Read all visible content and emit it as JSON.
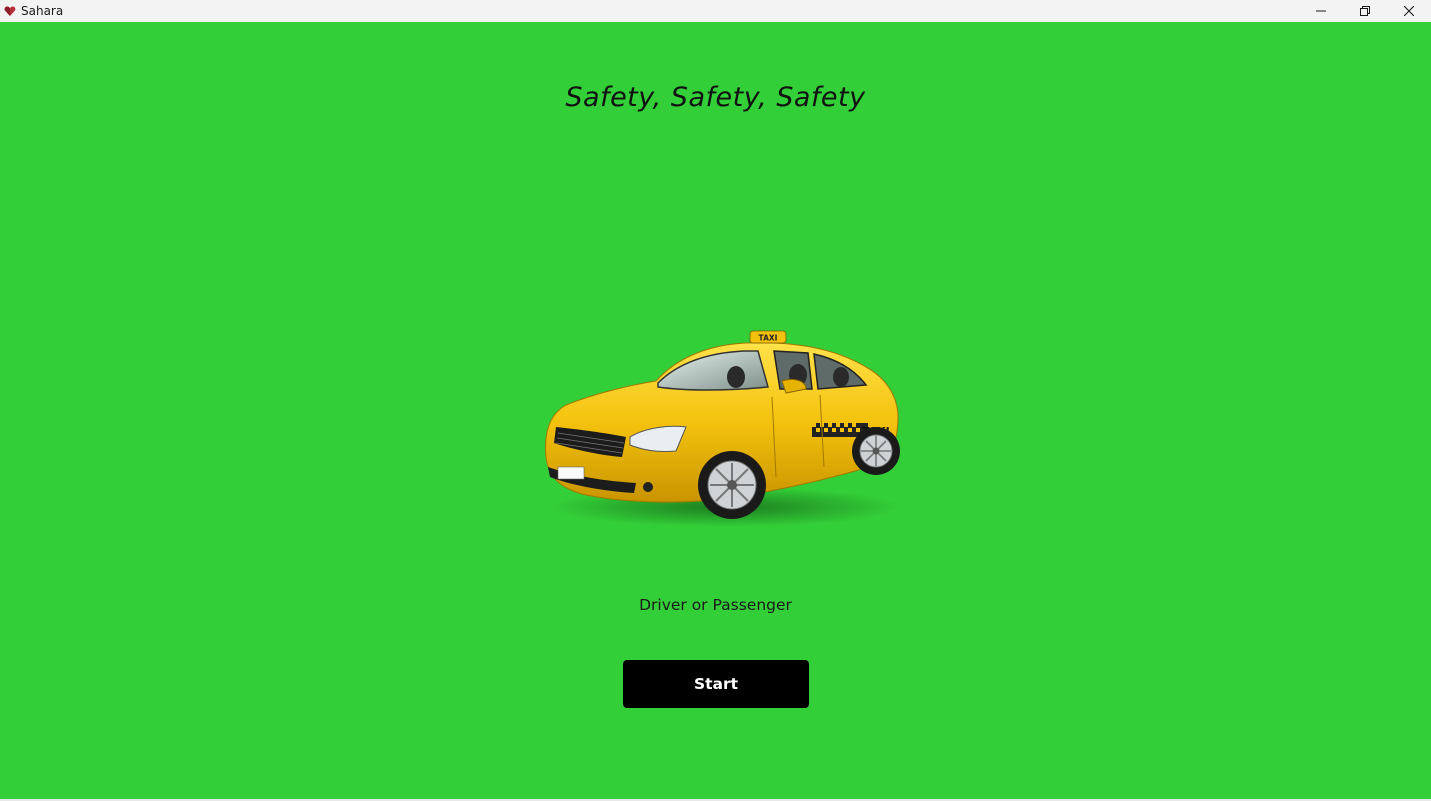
{
  "window": {
    "title": "Sahara",
    "app_icon": "heart-gem-icon",
    "controls": [
      "minimize-icon",
      "restore-icon",
      "close-icon"
    ]
  },
  "main": {
    "headline": "Safety, Safety, Safety",
    "hero_image": "yellow-taxi-car",
    "subtitle": "Driver or Passenger",
    "start_label": "Start"
  },
  "colors": {
    "background": "#33cf38",
    "button": "#000000",
    "button_text": "#ffffff",
    "taxi_yellow": "#f5c518"
  }
}
